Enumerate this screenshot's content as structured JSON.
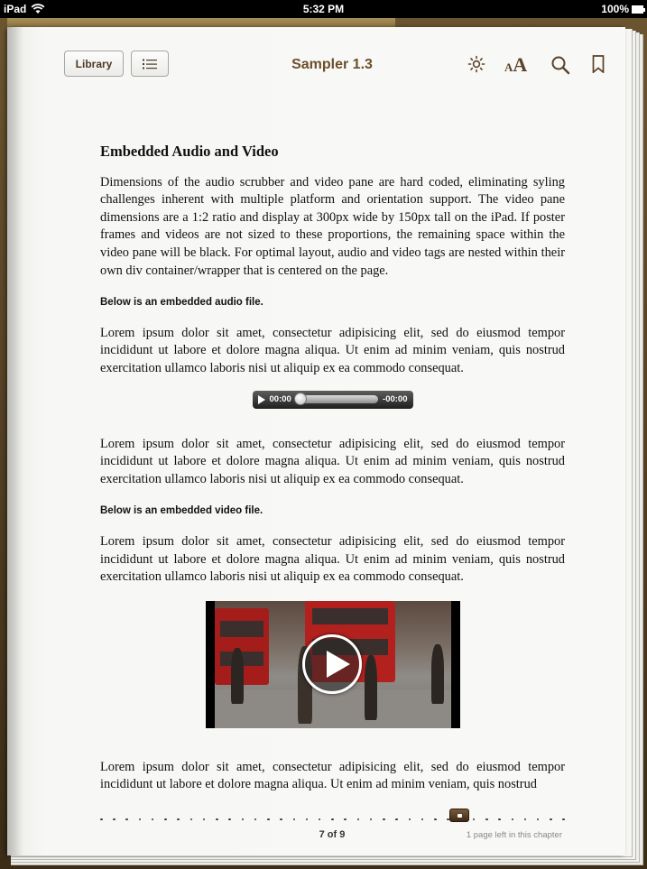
{
  "status_bar": {
    "device": "iPad",
    "time": "5:32 PM",
    "battery": "100%"
  },
  "toolbar": {
    "library_label": "Library",
    "book_title": "Sampler 1.3",
    "font_small": "A",
    "font_big": "A"
  },
  "content": {
    "heading": "Embedded Audio and Video",
    "intro": "Dimensions of the audio scrubber and video pane are hard coded, eliminating syling challenges inherent with multiple platform and orientation support. The video pane dimensions are a 1:2 ratio and display at 300px wide by 150px tall on the iPad. If poster frames and videos are not sized to these proportions, the remaining space within the video pane will be black. For optimal layout, audio and video tags are nested within their own div container/wrapper that is centered on the page.",
    "audio_heading": "Below is an embedded audio file.",
    "lorem1": "Lorem ipsum dolor sit amet, consectetur adipisicing elit, sed do eiusmod tempor incididunt ut labore et dolore magna aliqua. Ut enim ad minim veniam, quis nostrud exercitation ullamco laboris nisi ut aliquip ex ea commodo consequat.",
    "audio": {
      "elapsed": "00:00",
      "remaining": "-00:00"
    },
    "lorem2": "Lorem ipsum dolor sit amet, consectetur adipisicing elit, sed do eiusmod tempor incididunt ut labore et dolore magna aliqua. Ut enim ad minim veniam, quis nostrud exercitation ullamco laboris nisi ut aliquip ex ea commodo consequat.",
    "video_heading": "Below is an embedded video file.",
    "lorem3": "Lorem ipsum dolor sit amet, consectetur adipisicing elit, sed do eiusmod tempor incididunt ut labore et dolore magna aliqua. Ut enim ad minim veniam, quis nostrud exercitation ullamco laboris nisi ut aliquip ex ea commodo consequat.",
    "lorem4": "Lorem ipsum dolor sit amet, consectetur adipisicing elit, sed do eiusmod tempor incididunt ut labore et dolore magna aliqua. Ut enim ad minim veniam, quis nostrud"
  },
  "footer": {
    "page_count": "7 of 9",
    "pages_left": "1 page left in this chapter",
    "current_page": 7,
    "total_pages": 9
  },
  "icons": {
    "toc": "list-icon",
    "brightness": "sun-icon",
    "font": "font-size-icon",
    "search": "magnifier-icon",
    "bookmark": "bookmark-icon",
    "video_play": "play-circle-icon"
  },
  "colors": {
    "title_brown": "#6d4e2a",
    "page": "#f8f8f6",
    "text": "#111111"
  }
}
